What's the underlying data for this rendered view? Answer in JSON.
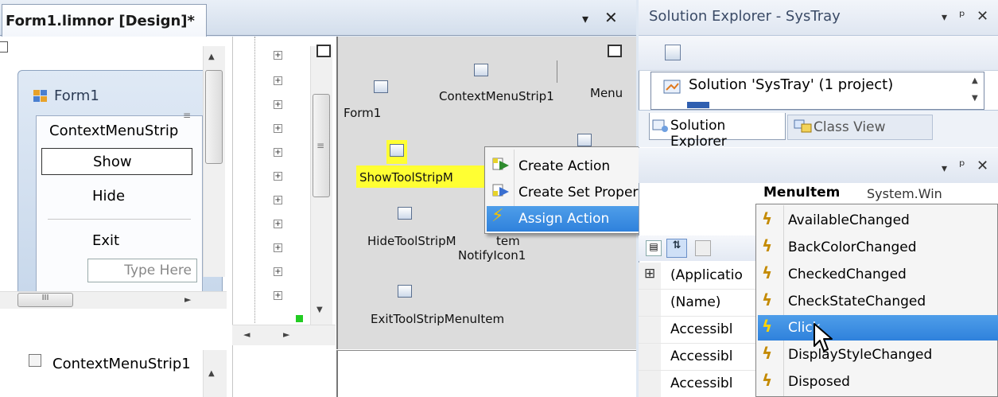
{
  "document": {
    "tab_title": "Form1.limnor [Design]*",
    "pin_glyph": "▾",
    "close_glyph": "✕"
  },
  "designer": {
    "form_title": "Form1",
    "context_menu_strip_label": "ContextMenuStrip",
    "menu_items": [
      "Show",
      "Hide",
      "Exit"
    ],
    "type_here_placeholder": "Type Here",
    "scroll_grip": "III",
    "tray_component": "ContextMenuStrip1"
  },
  "component_tray": {
    "labels": {
      "form1": "Form1",
      "context_menu_strip1": "ContextMenuStrip1",
      "menu": "Menu",
      "show_tool_strip": "ShowToolStripM",
      "hide_tool_strip": "HideToolStripM",
      "tem": "tem",
      "notify_icon1": "NotifyIcon1",
      "exit_tool_strip": "ExitToolStripMenuItem"
    }
  },
  "context_menu": {
    "items": [
      "Create Action",
      "Create Set Property Action",
      "Assign Action"
    ],
    "selected": "Assign Action"
  },
  "assign_submenu": {
    "items": [
      "AvailableChanged",
      "BackColorChanged",
      "CheckedChanged",
      "CheckStateChanged",
      "Click",
      "DisplayStyleChanged",
      "Disposed"
    ],
    "selected": "Click"
  },
  "solution_explorer": {
    "title": "Solution Explorer - SysTray",
    "solution_item": "Solution 'SysTray' (1 project)",
    "tabs": [
      "Solution Explorer",
      "Class View"
    ],
    "active_tab": "Solution Explorer"
  },
  "properties": {
    "object_name_partial": "MenuItem",
    "object_type_partial": "System.Win",
    "rows": [
      "(Applicatio",
      "(Name)",
      "Accessibl",
      "Accessibl",
      "Accessibl"
    ],
    "expand_glyph": "⊞"
  },
  "colors": {
    "selection_blue": "#3a8ee6",
    "highlight_yellow": "#ffff33",
    "bolt_color": "#c48a00"
  }
}
